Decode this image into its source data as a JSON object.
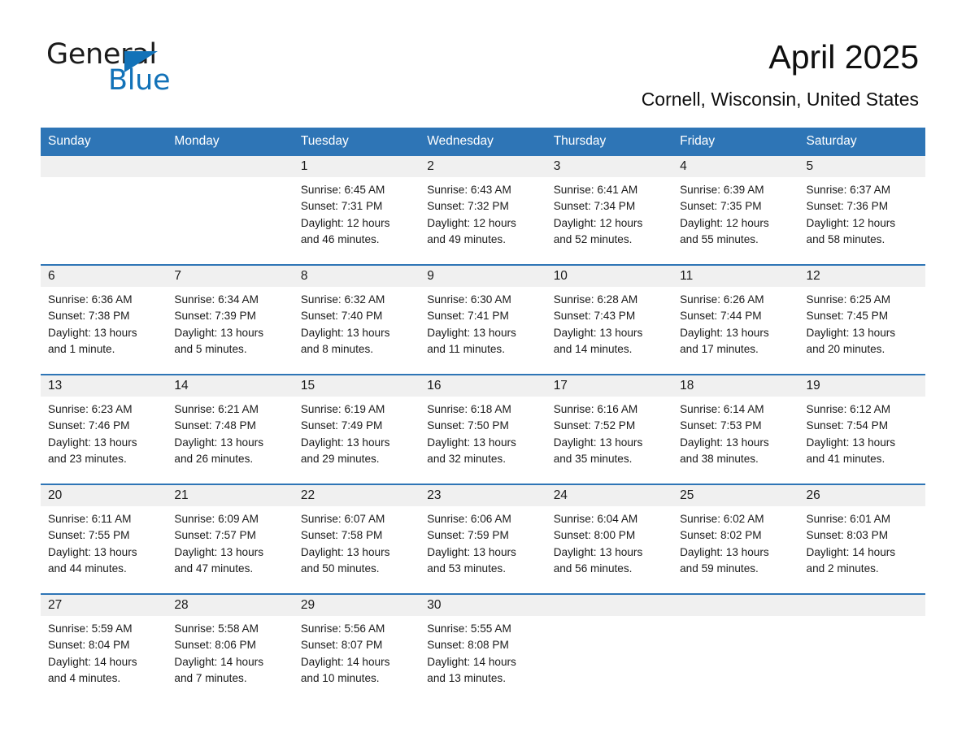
{
  "brand": {
    "name_part1": "General",
    "name_part2": "Blue",
    "triangle_icon": "brand-triangle-icon",
    "accent_color": "#1272b8"
  },
  "header": {
    "month_title": "April 2025",
    "location": "Cornell, Wisconsin, United States"
  },
  "theme": {
    "header_blue": "#2e75b6",
    "row_divider_blue": "#2e75b6",
    "daynum_strip_gray": "#f0f0f0",
    "text_color": "#1a1a1a"
  },
  "weekday_headers": [
    "Sunday",
    "Monday",
    "Tuesday",
    "Wednesday",
    "Thursday",
    "Friday",
    "Saturday"
  ],
  "weeks": [
    [
      {
        "day": "",
        "empty": true,
        "sunrise": "",
        "sunset": "",
        "daylight_1": "",
        "daylight_2": ""
      },
      {
        "day": "",
        "empty": true,
        "sunrise": "",
        "sunset": "",
        "daylight_1": "",
        "daylight_2": ""
      },
      {
        "day": "1",
        "sunrise": "Sunrise: 6:45 AM",
        "sunset": "Sunset: 7:31 PM",
        "daylight_1": "Daylight: 12 hours",
        "daylight_2": "and 46 minutes."
      },
      {
        "day": "2",
        "sunrise": "Sunrise: 6:43 AM",
        "sunset": "Sunset: 7:32 PM",
        "daylight_1": "Daylight: 12 hours",
        "daylight_2": "and 49 minutes."
      },
      {
        "day": "3",
        "sunrise": "Sunrise: 6:41 AM",
        "sunset": "Sunset: 7:34 PM",
        "daylight_1": "Daylight: 12 hours",
        "daylight_2": "and 52 minutes."
      },
      {
        "day": "4",
        "sunrise": "Sunrise: 6:39 AM",
        "sunset": "Sunset: 7:35 PM",
        "daylight_1": "Daylight: 12 hours",
        "daylight_2": "and 55 minutes."
      },
      {
        "day": "5",
        "sunrise": "Sunrise: 6:37 AM",
        "sunset": "Sunset: 7:36 PM",
        "daylight_1": "Daylight: 12 hours",
        "daylight_2": "and 58 minutes."
      }
    ],
    [
      {
        "day": "6",
        "sunrise": "Sunrise: 6:36 AM",
        "sunset": "Sunset: 7:38 PM",
        "daylight_1": "Daylight: 13 hours",
        "daylight_2": "and 1 minute."
      },
      {
        "day": "7",
        "sunrise": "Sunrise: 6:34 AM",
        "sunset": "Sunset: 7:39 PM",
        "daylight_1": "Daylight: 13 hours",
        "daylight_2": "and 5 minutes."
      },
      {
        "day": "8",
        "sunrise": "Sunrise: 6:32 AM",
        "sunset": "Sunset: 7:40 PM",
        "daylight_1": "Daylight: 13 hours",
        "daylight_2": "and 8 minutes."
      },
      {
        "day": "9",
        "sunrise": "Sunrise: 6:30 AM",
        "sunset": "Sunset: 7:41 PM",
        "daylight_1": "Daylight: 13 hours",
        "daylight_2": "and 11 minutes."
      },
      {
        "day": "10",
        "sunrise": "Sunrise: 6:28 AM",
        "sunset": "Sunset: 7:43 PM",
        "daylight_1": "Daylight: 13 hours",
        "daylight_2": "and 14 minutes."
      },
      {
        "day": "11",
        "sunrise": "Sunrise: 6:26 AM",
        "sunset": "Sunset: 7:44 PM",
        "daylight_1": "Daylight: 13 hours",
        "daylight_2": "and 17 minutes."
      },
      {
        "day": "12",
        "sunrise": "Sunrise: 6:25 AM",
        "sunset": "Sunset: 7:45 PM",
        "daylight_1": "Daylight: 13 hours",
        "daylight_2": "and 20 minutes."
      }
    ],
    [
      {
        "day": "13",
        "sunrise": "Sunrise: 6:23 AM",
        "sunset": "Sunset: 7:46 PM",
        "daylight_1": "Daylight: 13 hours",
        "daylight_2": "and 23 minutes."
      },
      {
        "day": "14",
        "sunrise": "Sunrise: 6:21 AM",
        "sunset": "Sunset: 7:48 PM",
        "daylight_1": "Daylight: 13 hours",
        "daylight_2": "and 26 minutes."
      },
      {
        "day": "15",
        "sunrise": "Sunrise: 6:19 AM",
        "sunset": "Sunset: 7:49 PM",
        "daylight_1": "Daylight: 13 hours",
        "daylight_2": "and 29 minutes."
      },
      {
        "day": "16",
        "sunrise": "Sunrise: 6:18 AM",
        "sunset": "Sunset: 7:50 PM",
        "daylight_1": "Daylight: 13 hours",
        "daylight_2": "and 32 minutes."
      },
      {
        "day": "17",
        "sunrise": "Sunrise: 6:16 AM",
        "sunset": "Sunset: 7:52 PM",
        "daylight_1": "Daylight: 13 hours",
        "daylight_2": "and 35 minutes."
      },
      {
        "day": "18",
        "sunrise": "Sunrise: 6:14 AM",
        "sunset": "Sunset: 7:53 PM",
        "daylight_1": "Daylight: 13 hours",
        "daylight_2": "and 38 minutes."
      },
      {
        "day": "19",
        "sunrise": "Sunrise: 6:12 AM",
        "sunset": "Sunset: 7:54 PM",
        "daylight_1": "Daylight: 13 hours",
        "daylight_2": "and 41 minutes."
      }
    ],
    [
      {
        "day": "20",
        "sunrise": "Sunrise: 6:11 AM",
        "sunset": "Sunset: 7:55 PM",
        "daylight_1": "Daylight: 13 hours",
        "daylight_2": "and 44 minutes."
      },
      {
        "day": "21",
        "sunrise": "Sunrise: 6:09 AM",
        "sunset": "Sunset: 7:57 PM",
        "daylight_1": "Daylight: 13 hours",
        "daylight_2": "and 47 minutes."
      },
      {
        "day": "22",
        "sunrise": "Sunrise: 6:07 AM",
        "sunset": "Sunset: 7:58 PM",
        "daylight_1": "Daylight: 13 hours",
        "daylight_2": "and 50 minutes."
      },
      {
        "day": "23",
        "sunrise": "Sunrise: 6:06 AM",
        "sunset": "Sunset: 7:59 PM",
        "daylight_1": "Daylight: 13 hours",
        "daylight_2": "and 53 minutes."
      },
      {
        "day": "24",
        "sunrise": "Sunrise: 6:04 AM",
        "sunset": "Sunset: 8:00 PM",
        "daylight_1": "Daylight: 13 hours",
        "daylight_2": "and 56 minutes."
      },
      {
        "day": "25",
        "sunrise": "Sunrise: 6:02 AM",
        "sunset": "Sunset: 8:02 PM",
        "daylight_1": "Daylight: 13 hours",
        "daylight_2": "and 59 minutes."
      },
      {
        "day": "26",
        "sunrise": "Sunrise: 6:01 AM",
        "sunset": "Sunset: 8:03 PM",
        "daylight_1": "Daylight: 14 hours",
        "daylight_2": "and 2 minutes."
      }
    ],
    [
      {
        "day": "27",
        "sunrise": "Sunrise: 5:59 AM",
        "sunset": "Sunset: 8:04 PM",
        "daylight_1": "Daylight: 14 hours",
        "daylight_2": "and 4 minutes."
      },
      {
        "day": "28",
        "sunrise": "Sunrise: 5:58 AM",
        "sunset": "Sunset: 8:06 PM",
        "daylight_1": "Daylight: 14 hours",
        "daylight_2": "and 7 minutes."
      },
      {
        "day": "29",
        "sunrise": "Sunrise: 5:56 AM",
        "sunset": "Sunset: 8:07 PM",
        "daylight_1": "Daylight: 14 hours",
        "daylight_2": "and 10 minutes."
      },
      {
        "day": "30",
        "sunrise": "Sunrise: 5:55 AM",
        "sunset": "Sunset: 8:08 PM",
        "daylight_1": "Daylight: 14 hours",
        "daylight_2": "and 13 minutes."
      },
      {
        "day": "",
        "empty": true,
        "sunrise": "",
        "sunset": "",
        "daylight_1": "",
        "daylight_2": ""
      },
      {
        "day": "",
        "empty": true,
        "sunrise": "",
        "sunset": "",
        "daylight_1": "",
        "daylight_2": ""
      },
      {
        "day": "",
        "empty": true,
        "sunrise": "",
        "sunset": "",
        "daylight_1": "",
        "daylight_2": ""
      }
    ]
  ]
}
